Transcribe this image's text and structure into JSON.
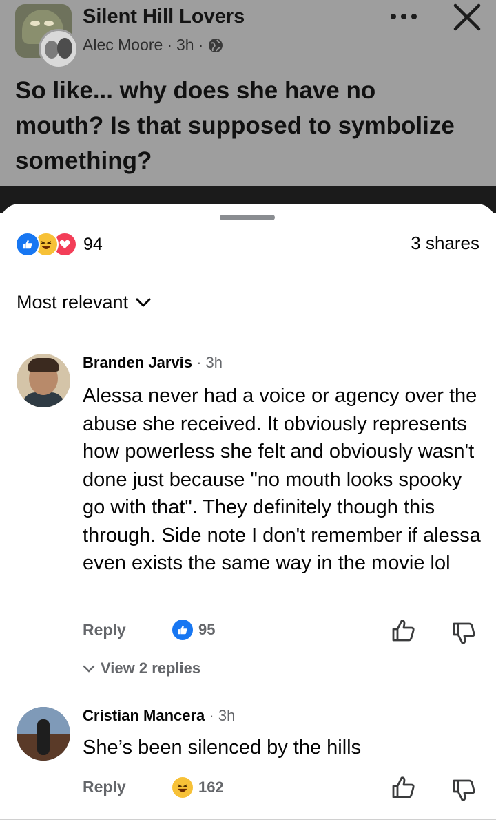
{
  "post": {
    "group_name": "Silent Hill Lovers",
    "author": "Alec Moore",
    "time": "3h",
    "separator": "·",
    "text": "So like... why does she have no mouth? Is that supposed to symbolize something?",
    "icons": {
      "group_avatar": "group-avatar-image",
      "author_avatar": "author-avatar-image",
      "privacy": "globe-icon",
      "more": "more-options-icon",
      "close": "close-icon"
    }
  },
  "engagement": {
    "reaction_icons": [
      "like-icon",
      "haha-icon",
      "love-icon"
    ],
    "reaction_count": "94",
    "shares": "3 shares"
  },
  "sort": {
    "label": "Most relevant",
    "icon": "chevron-down-icon"
  },
  "comments": [
    {
      "author": "Branden Jarvis",
      "separator": "·",
      "time": "3h",
      "text": "Alessa never had a voice or agency over the abuse she received. It obviously represents how powerless she felt and obviously wasn't done just because \"no mouth looks spooky go with that\". They definitely though this through. Side note I don't remember if alessa even exists the same way in the movie lol",
      "reply_label": "Reply",
      "reaction_icon": "like-icon",
      "reaction_count": "95",
      "view_replies": "View 2 replies"
    },
    {
      "author": "Cristian Mancera",
      "separator": "·",
      "time": "3h",
      "text": "She’s been silenced by the hills",
      "reply_label": "Reply",
      "reaction_icon": "haha-icon",
      "reaction_count": "162"
    }
  ],
  "colors": {
    "header_bg": "#9e9e9e",
    "like_blue": "#1877f2",
    "haha_yellow": "#f7c137",
    "love_red": "#f33e58",
    "secondary_text": "#65676b"
  }
}
